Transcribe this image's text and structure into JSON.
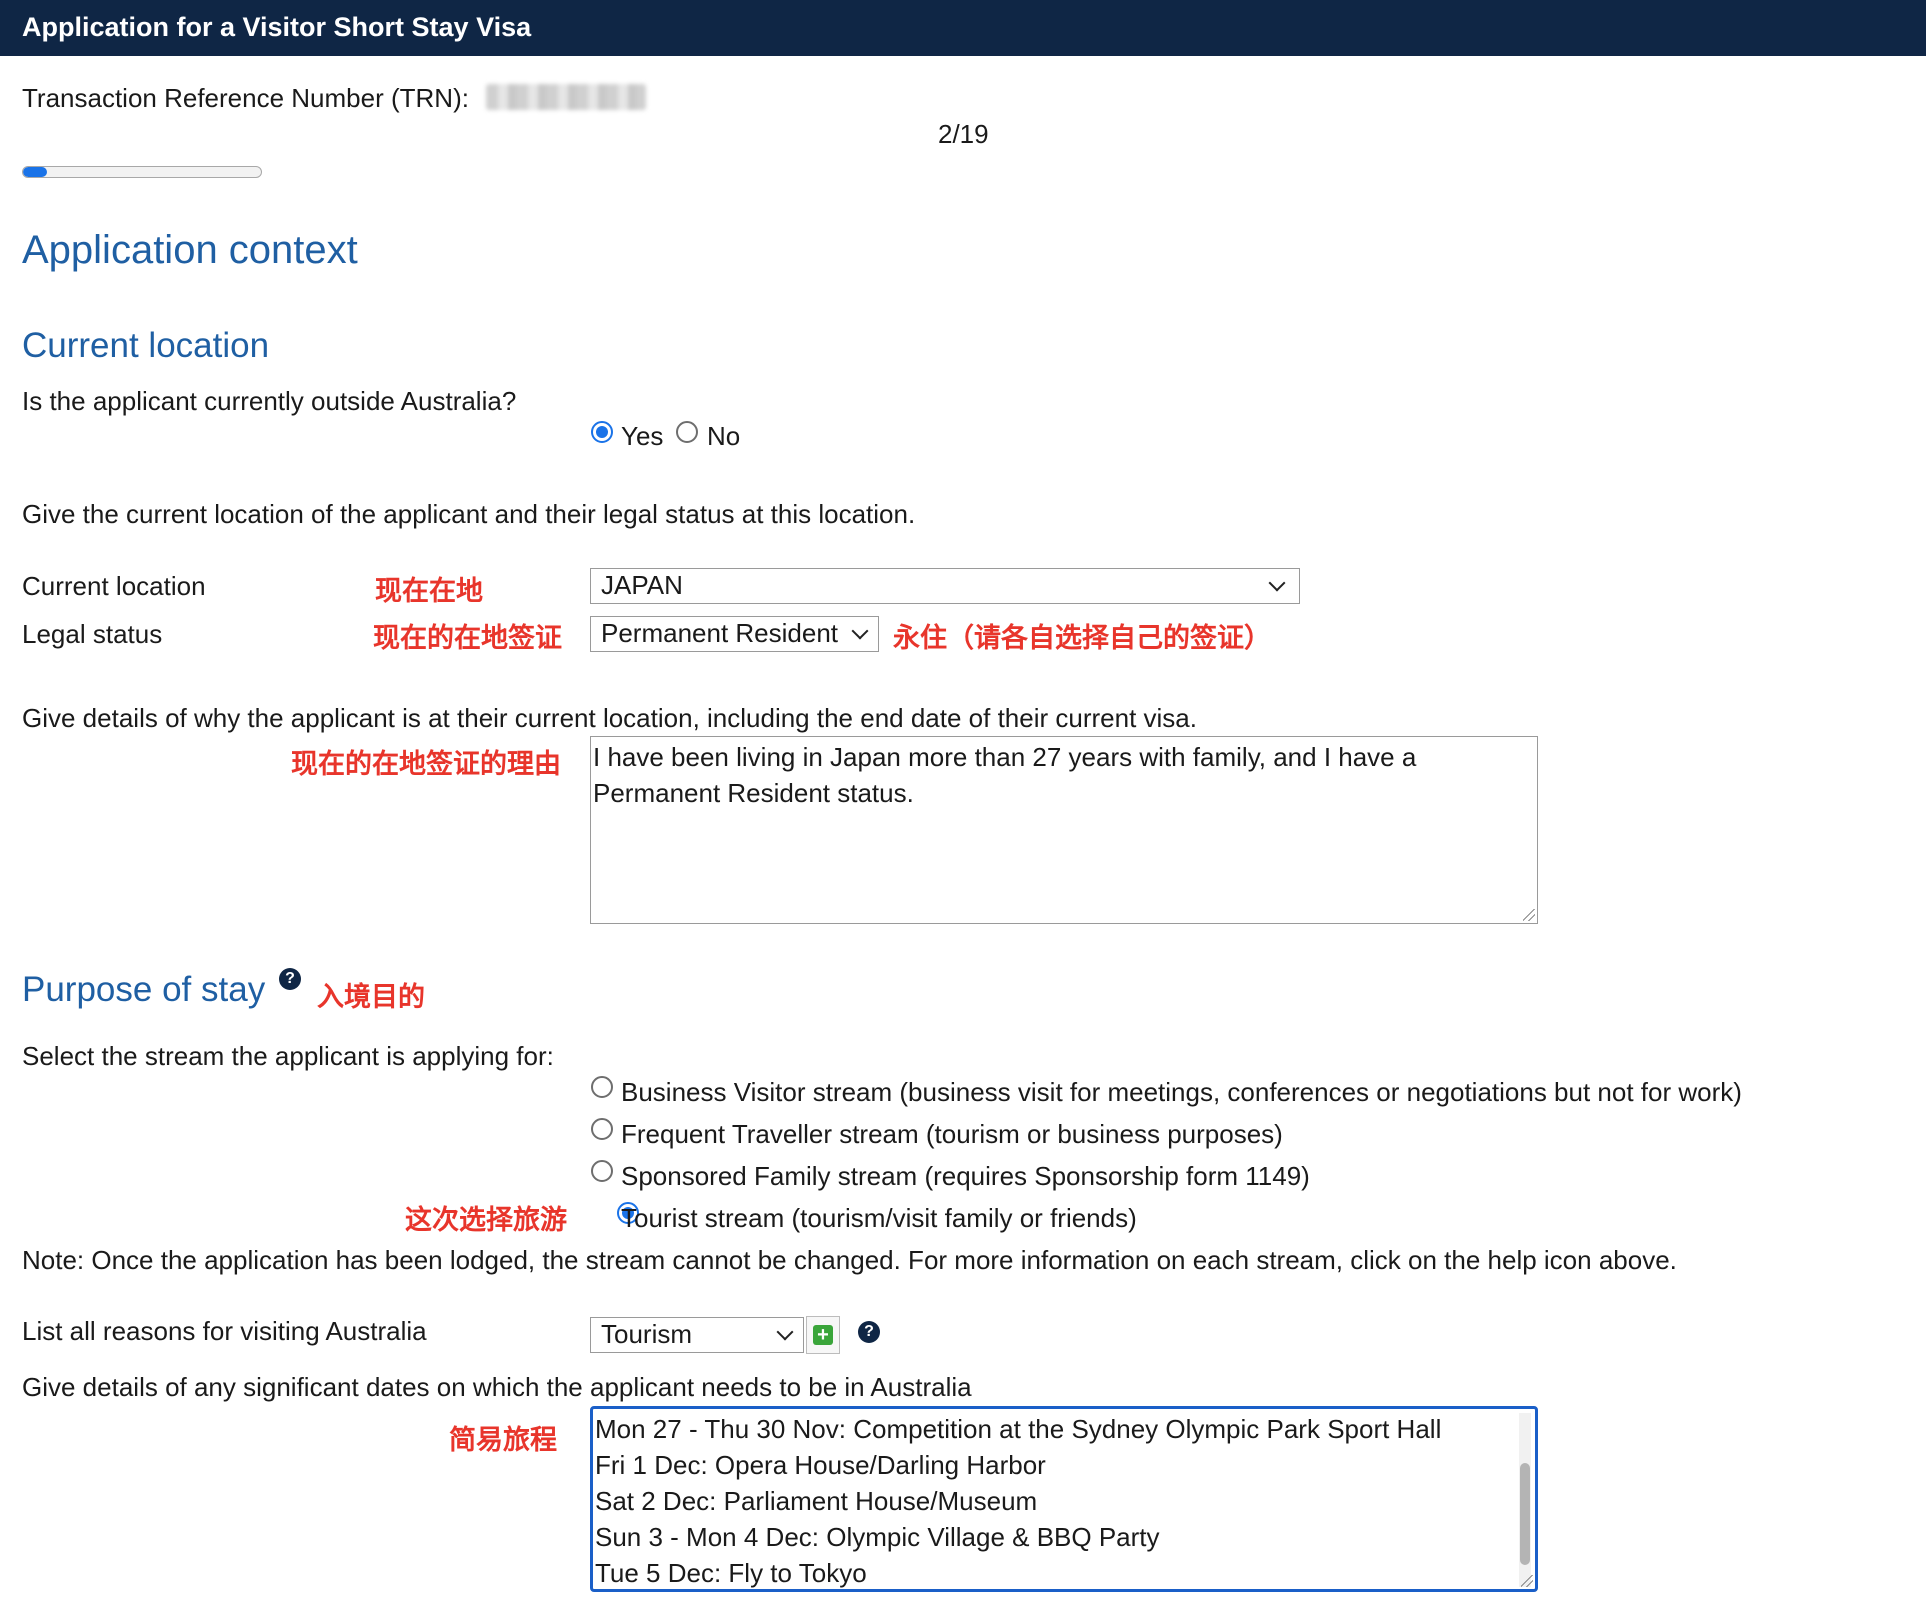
{
  "header": {
    "title": "Application for a Visitor Short Stay Visa"
  },
  "trn": {
    "label": "Transaction Reference Number (TRN):"
  },
  "progress": {
    "text": "2/19",
    "current": 2,
    "total": 19,
    "fill_fraction": 0.1
  },
  "page_title": "Application context",
  "current_location_section": {
    "heading": "Current location",
    "question": "Is the applicant currently outside Australia?",
    "yes_label": "Yes",
    "no_label": "No",
    "selected": "Yes",
    "instruction": "Give the current location of the applicant and their legal status at this location.",
    "location_label": "Current location",
    "location_value": "JAPAN",
    "legal_status_label": "Legal status",
    "legal_status_value": "Permanent Resident",
    "details_prompt": "Give details of why the applicant is at their current location, including the end date of their current visa.",
    "details_value": "I have been living in Japan more than 27 years with family, and I have a Permanent Resident status."
  },
  "annotations": {
    "location": "现在在地",
    "legal_status": "现在的在地签证",
    "legal_status_note": "永住（请各自选择自己的签证）",
    "reason": "现在的在地签证的理由",
    "purpose": "入境目的",
    "tourist": "这次选择旅游",
    "itinerary": "简易旅程"
  },
  "purpose_section": {
    "heading": "Purpose of stay",
    "help_icon": "question-circle-icon",
    "stream_prompt": "Select the stream the applicant is applying for:",
    "streams": [
      {
        "label": "Business Visitor stream (business visit for meetings, conferences or negotiations but not for work)",
        "checked": false
      },
      {
        "label": "Frequent Traveller stream (tourism or business purposes)",
        "checked": false
      },
      {
        "label": "Sponsored Family stream (requires Sponsorship form 1149)",
        "checked": false
      },
      {
        "label": "Tourist stream (tourism/visit family or friends)",
        "checked": true
      }
    ],
    "note": "Note: Once the application has been lodged, the stream cannot be changed. For more information on each stream, click on the help icon above.",
    "reasons_label": "List all reasons for visiting Australia",
    "reasons_value": "Tourism",
    "add_icon": "plus-square-icon",
    "dates_prompt": "Give details of any significant dates on which the applicant needs to be in Australia",
    "dates_lines": [
      "Mon 27 - Thu 30 Nov: Competition at the Sydney Olympic Park Sport Hall",
      "Fri 1 Dec: Opera House/Darling Harbor",
      "Sat 2 Dec: Parliament House/Museum",
      "Sun 3 - Mon 4 Dec: Olympic Village & BBQ Party",
      "Tue 5 Dec: Fly to Tokyo"
    ]
  },
  "colors": {
    "header_bg": "#0f2645",
    "heading": "#1f5fa3",
    "annotation": "#e8352b",
    "accent": "#1a73e8"
  }
}
